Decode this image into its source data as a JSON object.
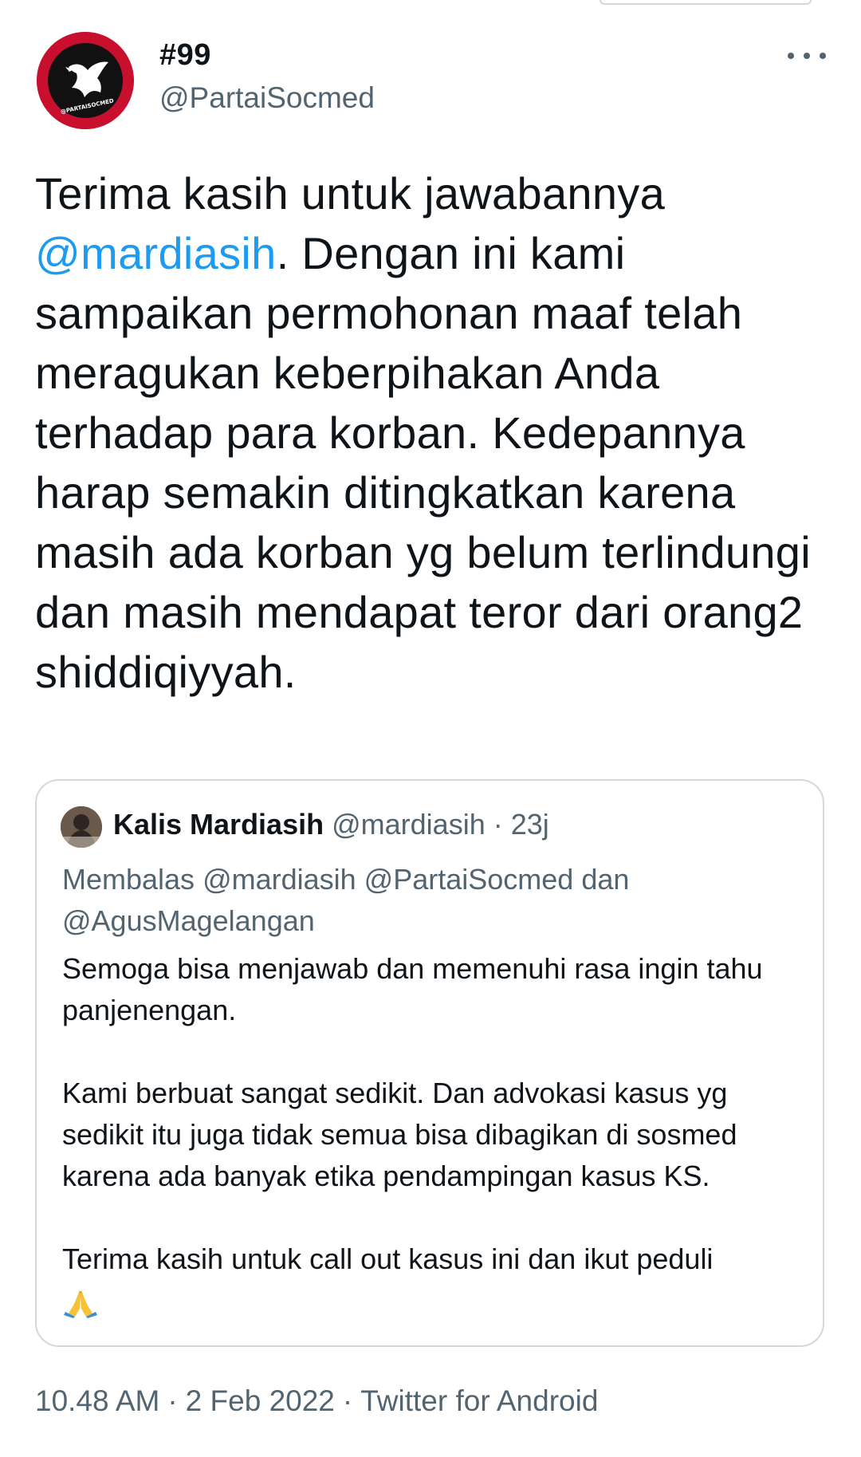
{
  "author": {
    "display_name": "#99",
    "handle": "@PartaiSocmed",
    "avatar_icon": "red-dove-logo-icon",
    "avatar_text": "@PARTAISOCMED"
  },
  "more_icon": "more-horizontal-icon",
  "tweet": {
    "text_before": "Terima kasih untuk jawabannya ",
    "mention": "@mardiasih",
    "text_after": ". Dengan ini kami sampaikan permohonan maaf telah meragukan keberpihakan Anda terhadap para korban. Kedepannya harap semakin ditingkatkan karena masih ada korban yg belum terlindungi dan masih mendapat teror dari orang2 shiddiqiyyah."
  },
  "quoted_tweet": {
    "display_name": "Kalis Mardiasih",
    "handle": "@mardiasih",
    "separator": "·",
    "time_ago": "23j",
    "reply_to": "Membalas @mardiasih @PartaiSocmed dan @AgusMagelangan",
    "paragraphs": [
      "Semoga bisa menjawab dan memenuhi rasa ingin tahu panjenengan.",
      "Kami berbuat sangat sedikit. Dan advokasi kasus yg sedikit itu juga tidak semua bisa dibagikan di sosmed karena ada banyak etika pendampingan kasus KS.",
      "Terima kasih untuk call out kasus ini dan ikut peduli"
    ],
    "emoji_icon": "folded-hands-icon"
  },
  "footer": {
    "time": "10.48 AM",
    "date": "2 Feb 2022",
    "source": "Twitter for Android",
    "separator": "·"
  },
  "colors": {
    "text": "#0f1419",
    "secondary": "#536471",
    "link": "#1d9bf0",
    "border": "#cfd9de",
    "avatar_red": "#c8102e"
  }
}
